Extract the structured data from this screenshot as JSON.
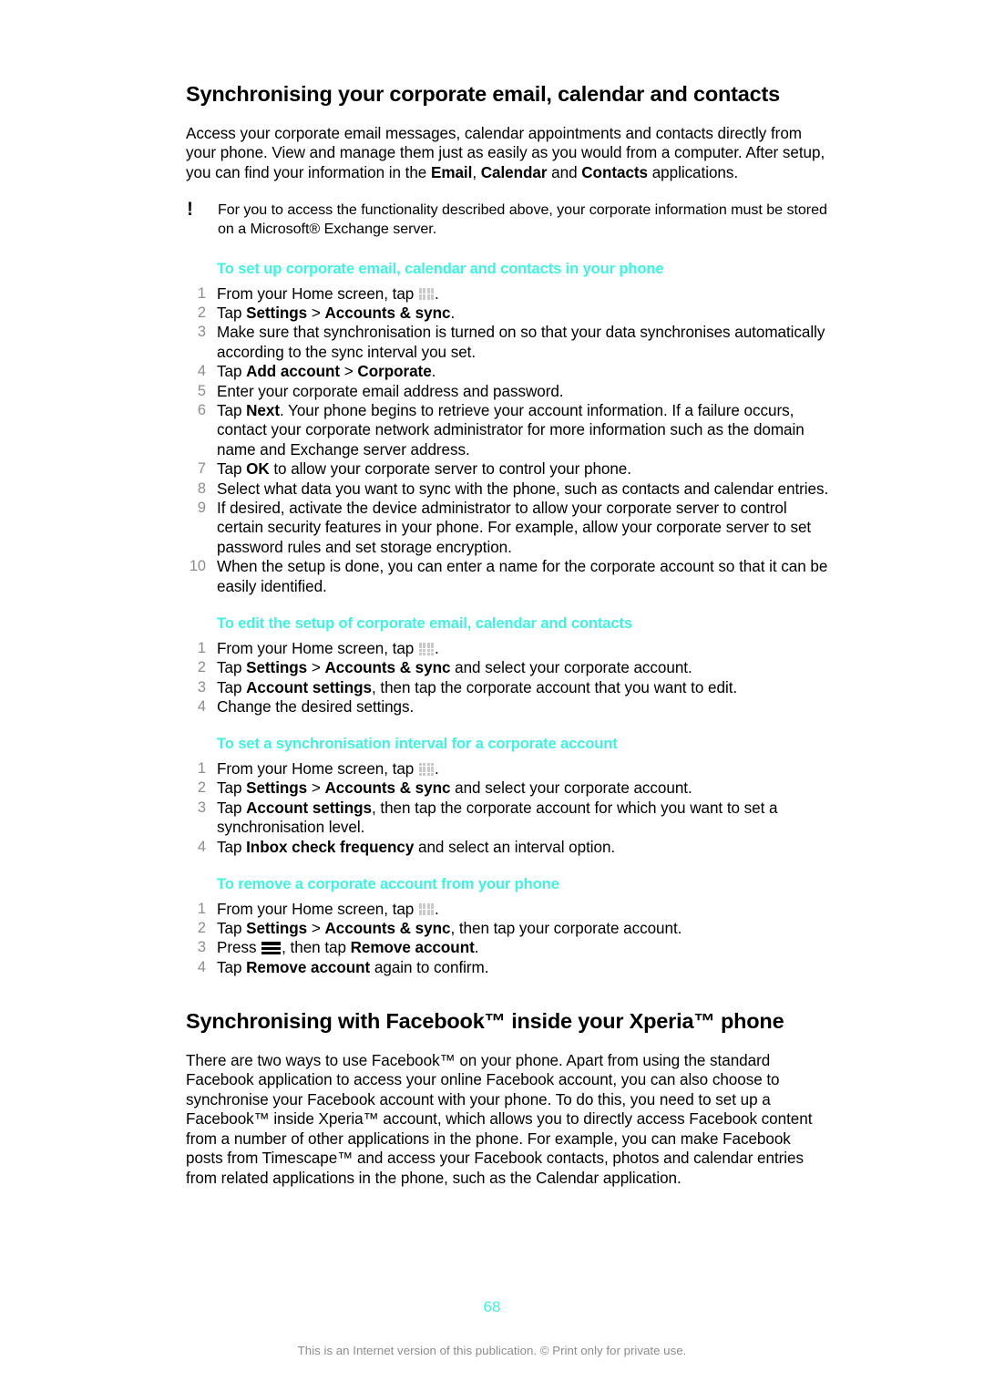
{
  "document": {
    "page_number": "68",
    "footer_note": "This is an Internet version of this publication. © Print only for private use.",
    "accent_color": "#3cf4e0",
    "number_color": "#8d8d8d"
  },
  "section1": {
    "heading": "Synchronising your corporate email, calendar and contacts",
    "intro": {
      "part1": "Access your corporate email messages, calendar appointments and contacts directly from your phone. View and manage them just as easily as you would from a computer. After setup, you can find your information in the ",
      "bold1": "Email",
      "part2": ", ",
      "bold2": "Calendar",
      "part3": " and ",
      "bold3": "Contacts",
      "part4": " applications."
    },
    "note": {
      "icon": "exclamation-icon",
      "text": "For you to access the functionality described above, your corporate information must be stored on a Microsoft® Exchange server."
    },
    "sub1": {
      "heading": "To set up corporate email, calendar and contacts in your phone",
      "steps": [
        {
          "num": "1",
          "pre": "From your Home screen, tap ",
          "icon": "app-grid-icon",
          "post": "."
        },
        {
          "num": "2",
          "pre": "Tap ",
          "b1": "Settings",
          "mid": " > ",
          "b2": "Accounts & sync",
          "post": "."
        },
        {
          "num": "3",
          "pre": "Make sure that synchronisation is turned on so that your data synchronises automatically according to the sync interval you set."
        },
        {
          "num": "4",
          "pre": "Tap ",
          "b1": "Add account",
          "mid": " > ",
          "b2": "Corporate",
          "post": "."
        },
        {
          "num": "5",
          "pre": "Enter your corporate email address and password."
        },
        {
          "num": "6",
          "pre": "Tap ",
          "b1": "Next",
          "post": ". Your phone begins to retrieve your account information. If a failure occurs, contact your corporate network administrator for more information such as the domain name and Exchange server address."
        },
        {
          "num": "7",
          "pre": "Tap ",
          "b1": "OK",
          "post": " to allow your corporate server to control your phone."
        },
        {
          "num": "8",
          "pre": "Select what data you want to sync with the phone, such as contacts and calendar entries."
        },
        {
          "num": "9",
          "pre": "If desired, activate the device administrator to allow your corporate server to control certain security features in your phone. For example, allow your corporate server to set password rules and set storage encryption."
        },
        {
          "num": "10",
          "pre": "When the setup is done, you can enter a name for the corporate account so that it can be easily identified."
        }
      ]
    },
    "sub2": {
      "heading": "To edit the setup of corporate email, calendar and contacts",
      "steps": [
        {
          "num": "1",
          "pre": "From your Home screen, tap ",
          "icon": "app-grid-icon",
          "post": "."
        },
        {
          "num": "2",
          "pre": "Tap ",
          "b1": "Settings",
          "mid": " > ",
          "b2": "Accounts & sync",
          "post": " and select your corporate account."
        },
        {
          "num": "3",
          "pre": "Tap ",
          "b1": "Account settings",
          "post": ", then tap the corporate account that you want to edit."
        },
        {
          "num": "4",
          "pre": "Change the desired settings."
        }
      ]
    },
    "sub3": {
      "heading": "To set a synchronisation interval for a corporate account",
      "steps": [
        {
          "num": "1",
          "pre": "From your Home screen, tap ",
          "icon": "app-grid-icon",
          "post": "."
        },
        {
          "num": "2",
          "pre": "Tap ",
          "b1": "Settings",
          "mid": " > ",
          "b2": "Accounts & sync",
          "post": " and select your corporate account."
        },
        {
          "num": "3",
          "pre": "Tap ",
          "b1": "Account settings",
          "post": ", then tap the corporate account for which you want to set a synchronisation level."
        },
        {
          "num": "4",
          "pre": "Tap ",
          "b1": "Inbox check frequency",
          "post": " and select an interval option."
        }
      ]
    },
    "sub4": {
      "heading": "To remove a corporate account from your phone",
      "steps": [
        {
          "num": "1",
          "pre": "From your Home screen, tap ",
          "icon": "app-grid-icon",
          "post": "."
        },
        {
          "num": "2",
          "pre": "Tap ",
          "b1": "Settings",
          "mid": " > ",
          "b2": "Accounts & sync",
          "post": ", then tap your corporate account."
        },
        {
          "num": "3",
          "pre": "Press ",
          "icon": "menu-icon",
          "mid": ", then tap ",
          "b1": "Remove account",
          "post": "."
        },
        {
          "num": "4",
          "pre": "Tap ",
          "b1": "Remove account",
          "post": " again to confirm."
        }
      ]
    }
  },
  "section2": {
    "heading": "Synchronising with Facebook™ inside your Xperia™ phone",
    "paragraph": "There are two ways to use Facebook™ on your phone. Apart from using the standard Facebook application to access your online Facebook account, you can also choose to synchronise your Facebook account with your phone. To do this, you need to set up a Facebook™ inside Xperia™ account, which allows you to directly access Facebook content from a number of other applications in the phone. For example, you can make Facebook posts from Timescape™ and access your Facebook contacts, photos and calendar entries from related applications in the phone, such as the Calendar application."
  }
}
